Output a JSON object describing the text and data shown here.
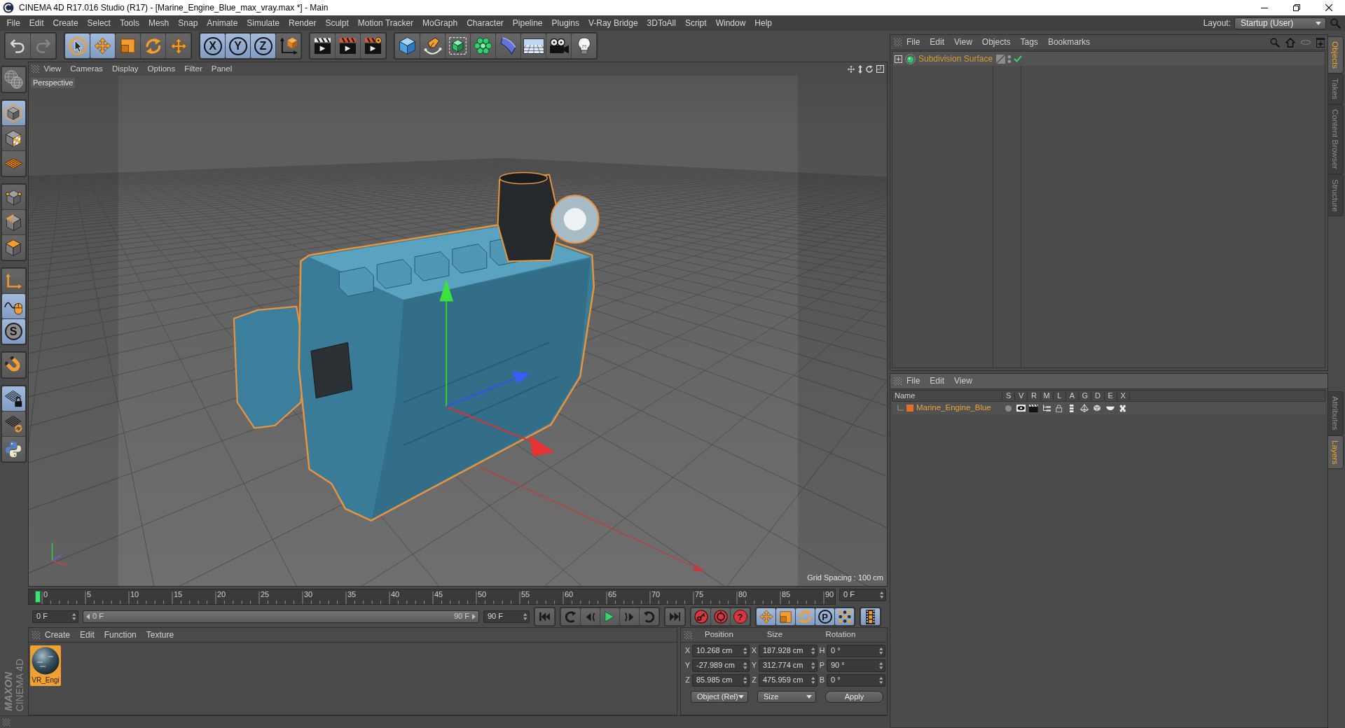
{
  "window": {
    "title": "CINEMA 4D R17.016 Studio (R17) - [Marine_Engine_Blue_max_vray.max *] - Main"
  },
  "menu_bar": {
    "items": [
      "File",
      "Edit",
      "Create",
      "Select",
      "Tools",
      "Mesh",
      "Snap",
      "Animate",
      "Simulate",
      "Render",
      "Sculpt",
      "Motion Tracker",
      "MoGraph",
      "Character",
      "Pipeline",
      "Plugins",
      "V-Ray Bridge",
      "3DToAll",
      "Script",
      "Window",
      "Help"
    ],
    "layout_label": "Layout:",
    "layout_value": "Startup (User)"
  },
  "toolbar": {
    "groups": [
      [
        {
          "kind": "undo",
          "selected": false,
          "disabled": false
        },
        {
          "kind": "redo",
          "selected": false,
          "disabled": true
        }
      ],
      [
        {
          "kind": "select",
          "selected": true,
          "disabled": false
        },
        {
          "kind": "move",
          "selected": true,
          "disabled": false
        },
        {
          "kind": "scale",
          "selected": false,
          "disabled": false
        },
        {
          "kind": "rotate",
          "selected": false,
          "disabled": false
        },
        {
          "kind": "transform",
          "selected": false,
          "disabled": false
        }
      ],
      [
        {
          "kind": "axis",
          "label": "X",
          "selected": true,
          "disabled": false
        },
        {
          "kind": "axis",
          "label": "Y",
          "selected": true,
          "disabled": false
        },
        {
          "kind": "axis",
          "label": "Z",
          "selected": true,
          "disabled": false
        },
        {
          "kind": "coordsystem",
          "selected": false,
          "disabled": false
        }
      ],
      [
        {
          "kind": "render",
          "selected": false,
          "disabled": false
        },
        {
          "kind": "renderview",
          "selected": false,
          "disabled": false
        },
        {
          "kind": "rendersettings",
          "selected": false,
          "disabled": false
        }
      ],
      [
        {
          "kind": "cube",
          "selected": false,
          "disabled": false
        },
        {
          "kind": "pen",
          "selected": false,
          "disabled": false
        },
        {
          "kind": "subdivision",
          "selected": false,
          "disabled": false
        },
        {
          "kind": "cloner",
          "selected": false,
          "disabled": false
        },
        {
          "kind": "deformer",
          "selected": false,
          "disabled": false
        },
        {
          "kind": "floor",
          "selected": false,
          "disabled": false
        },
        {
          "kind": "camera",
          "selected": false,
          "disabled": false
        },
        {
          "kind": "light",
          "selected": false,
          "disabled": false
        }
      ]
    ]
  },
  "modes": {
    "groups": [
      [
        {
          "kind": "editable",
          "selected": false
        }
      ],
      [
        {
          "kind": "model",
          "selected": true
        },
        {
          "kind": "texture",
          "selected": false
        },
        {
          "kind": "workplane",
          "selected": false
        }
      ],
      [
        {
          "kind": "points",
          "selected": false
        },
        {
          "kind": "edges",
          "selected": false
        },
        {
          "kind": "polygons",
          "selected": false
        }
      ],
      [
        {
          "kind": "axis",
          "selected": false
        },
        {
          "kind": "tweak",
          "selected": true
        },
        {
          "kind": "soft",
          "label": "S",
          "selected": true
        }
      ],
      [
        {
          "kind": "snap",
          "selected": false
        }
      ],
      [
        {
          "kind": "lockgrid",
          "selected": true
        },
        {
          "kind": "gridrotate",
          "selected": false
        },
        {
          "kind": "python",
          "selected": false
        }
      ]
    ]
  },
  "viewport": {
    "menu": [
      "View",
      "Cameras",
      "Display",
      "Options",
      "Filter",
      "Panel"
    ],
    "camera": "Perspective",
    "grid_spacing": "Grid Spacing : 100 cm"
  },
  "timeline": {
    "ticks": [
      "0",
      "5",
      "10",
      "15",
      "20",
      "25",
      "30",
      "35",
      "40",
      "45",
      "50",
      "55",
      "60",
      "65",
      "70",
      "75",
      "80",
      "85",
      "90"
    ],
    "playhead": {
      "level": 0
    },
    "current_frame": "0 F"
  },
  "playback": {
    "start_field": "0 F",
    "range": {
      "start": "0 F",
      "end": "90 F",
      "level": 1
    },
    "end_field": "90 F",
    "groups": [
      [
        {
          "kind": "first",
          "selected": false
        }
      ],
      [
        {
          "kind": "prevkey",
          "selected": false
        },
        {
          "kind": "prevframe",
          "selected": false
        },
        {
          "kind": "play",
          "selected": false
        },
        {
          "kind": "nextframe",
          "selected": false
        },
        {
          "kind": "nextkey",
          "selected": false
        }
      ],
      [
        {
          "kind": "last",
          "selected": false
        }
      ],
      [
        {
          "kind": "record",
          "selected": false
        },
        {
          "kind": "autokey",
          "selected": false
        },
        {
          "kind": "keyhelp",
          "label": "?",
          "selected": false
        }
      ],
      [
        {
          "kind": "position",
          "selected": true
        },
        {
          "kind": "scale",
          "selected": true
        },
        {
          "kind": "rotation",
          "selected": true
        },
        {
          "kind": "parameter",
          "label": "P",
          "selected": true
        },
        {
          "kind": "pla",
          "selected": true
        }
      ],
      [
        {
          "kind": "timeline",
          "selected": true
        }
      ]
    ]
  },
  "materials": {
    "menu": [
      "Create",
      "Edit",
      "Function",
      "Texture"
    ],
    "items": [
      {
        "name": "VR_Engi",
        "selected": true
      }
    ]
  },
  "coordinates": {
    "headers": [
      "Position",
      "Size",
      "Rotation"
    ],
    "rows": [
      {
        "position_axis": "X",
        "position": "10.268 cm",
        "size_axis": "X",
        "size": "187.928 cm",
        "rotation_axis": "H",
        "rotation": "0 °"
      },
      {
        "position_axis": "Y",
        "position": "-27.989 cm",
        "size_axis": "Y",
        "size": "312.774 cm",
        "rotation_axis": "P",
        "rotation": "90 °"
      },
      {
        "position_axis": "Z",
        "position": "85.985 cm",
        "size_axis": "Z",
        "size": "475.959 cm",
        "rotation_axis": "B",
        "rotation": "0 °"
      }
    ],
    "mode": "Object (Rel)",
    "size_mode": "Size",
    "apply": "Apply"
  },
  "logo": {
    "brand": "MAXON",
    "product": "CINEMA 4D"
  },
  "objects": {
    "menu": [
      "File",
      "Edit",
      "View",
      "Objects",
      "Tags",
      "Bookmarks"
    ],
    "items": [
      {
        "name": "Subdivision Surface",
        "selected": true,
        "expanded": false,
        "enabled": true
      }
    ]
  },
  "layers": {
    "menu": [
      "File",
      "Edit",
      "View"
    ],
    "columns": [
      "Name",
      "S",
      "V",
      "R",
      "M",
      "L",
      "A",
      "G",
      "D",
      "E",
      "X"
    ],
    "items": [
      {
        "name": "Marine_Engine_Blue",
        "color": "#e0702a",
        "selected": true
      }
    ]
  },
  "side_tabs": {
    "top": [
      {
        "label": "Objects",
        "selected": true
      },
      {
        "label": "Takes",
        "selected": false
      },
      {
        "label": "Content Browser",
        "selected": false
      },
      {
        "label": "Structure",
        "selected": false
      }
    ],
    "bottom": [
      {
        "label": "Attributes",
        "selected": false
      },
      {
        "label": "Layers",
        "selected": true
      }
    ]
  }
}
